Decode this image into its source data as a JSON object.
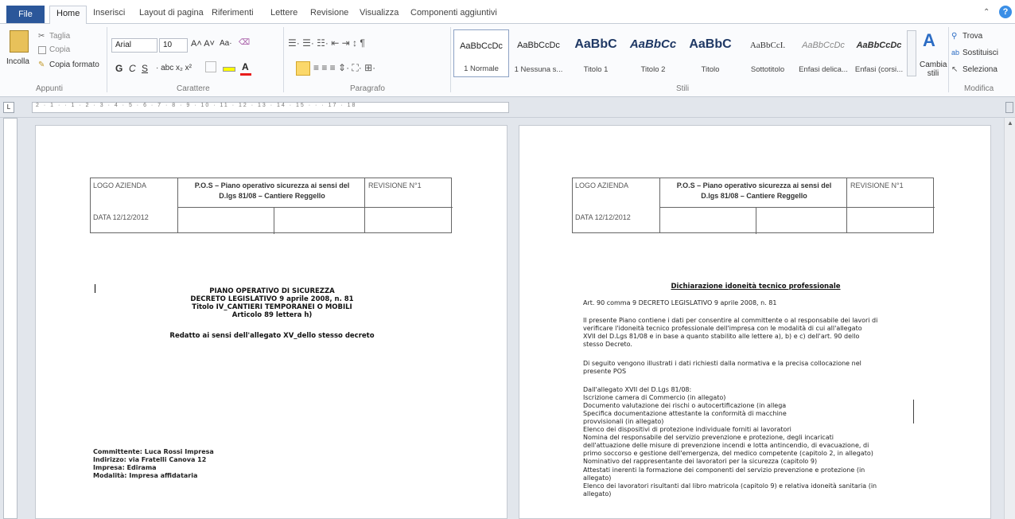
{
  "tabs": {
    "file": "File",
    "items": [
      "Home",
      "Inserisci",
      "Layout di pagina",
      "Riferimenti",
      "Lettere",
      "Revisione",
      "Visualizza",
      "Componenti aggiuntivi"
    ]
  },
  "ribbon": {
    "clipboard": {
      "paste": "Incolla",
      "cut": "Taglia",
      "copy": "Copia",
      "format_painter": "Copia formato",
      "group": "Appunti"
    },
    "font": {
      "name": "Arial",
      "size": "10",
      "group": "Carattere",
      "bold": "G",
      "italic": "C",
      "underline": "S"
    },
    "paragraph": {
      "group": "Paragrafo"
    },
    "styles": {
      "group": "Stili",
      "items": [
        {
          "preview": "AaBbCcDc",
          "name": "1 Normale"
        },
        {
          "preview": "AaBbCcDc",
          "name": "1 Nessuna s..."
        },
        {
          "preview": "AaBbC",
          "name": "Titolo 1"
        },
        {
          "preview": "AaBbCc",
          "name": "Titolo 2"
        },
        {
          "preview": "AaBbC",
          "name": "Titolo"
        },
        {
          "preview": "AaBbCcI.",
          "name": "Sottotitolo"
        },
        {
          "preview": "AaBbCcDc",
          "name": "Enfasi delica..."
        },
        {
          "preview": "AaBbCcDc",
          "name": "Enfasi (corsi..."
        }
      ],
      "change": "Cambia stili"
    },
    "editing": {
      "find": "Trova",
      "replace": "Sostituisci",
      "select": "Seleziona",
      "group": "Modifica"
    }
  },
  "ruler": {
    "ticks": "2 · 1 · · 1 · 2 · 3 · 4 · 5 · 6 · 7 · 8 · 9 · 10 · 11 · 12 · 13 · 14 · 15 · · · 17 · 18"
  },
  "header_table": {
    "logo": "LOGO AZIENDA",
    "title_line1": "P.O.S – Piano operativo sicurezza ai sensi del",
    "title_line2": "D.lgs 81/08 – Cantiere Reggello",
    "revision": "REVISIONE N°1",
    "date": "DATA 12/12/2012"
  },
  "page1": {
    "title": "PIANO OPERATIVO DI SICUREZZA",
    "decree": "DECRETO LEGISLATIVO 9 aprile 2008, n. 81",
    "titolo": "Titolo IV_CANTIERI TEMPORANEI O MOBILI",
    "article": "Articolo 89 lettera h)",
    "redatto": "Redatto ai sensi dell'allegato XV_dello stesso decreto",
    "committente": "Committente: Luca Rossi Impresa",
    "indirizzo": "Indirizzo: via Fratelli Canova 12",
    "impresa": "Impresa: Edirama",
    "modalita": "Modalità: Impresa affidataria"
  },
  "page2": {
    "heading": "Dichiarazione idoneità tecnico professionale",
    "lines": [
      "Art. 90 comma 9 DECRETO LEGISLATIVO 9 aprile 2008, n. 81",
      "",
      "Il presente Piano contiene i dati per consentire al committente o al responsabile dei lavori di",
      "verificare l'idoneità tecnico professionale dell'impresa con le modalità di cui all'allegato",
      "XVII del D.Lgs 81/08 e in base a quanto stabilito alle lettere a), b) e c) dell'art. 90 dello",
      "stesso Decreto.",
      "",
      "Di seguito vengono illustrati i dati richiesti dalla normativa e la precisa collocazione nel",
      "presente POS",
      "",
      "Dall'allegato XVII del D.Lgs 81/08:",
      "Iscrizione camera di Commercio (in allegato)",
      "Documento valutazione dei rischi o autocertificazione (in allega",
      "Specifica documentazione attestante la conformità di macchine",
      "provvisionali (in allegato)",
      "Elenco dei dispositivi di protezione individuale forniti ai lavoratori",
      "Nomina del responsabile del servizio prevenzione e protezione, degli incaricati",
      "dell'attuazione delle misure di prevenzione incendi e lotta antincendio, di evacuazione, di",
      "primo soccorso e gestione dell'emergenza, del medico competente (capitolo 2, in allegato)",
      "Nominativo del rappresentante dei lavoratori per la sicurezza (capitolo 9)",
      "Attestati inerenti la formazione dei componenti del servizio prevenzione e protezione (in",
      "allegato)",
      "Elenco dei lavoratori risultanti dal libro matricola (capitolo 9) e relativa idoneità sanitaria (in",
      "allegato)"
    ]
  }
}
